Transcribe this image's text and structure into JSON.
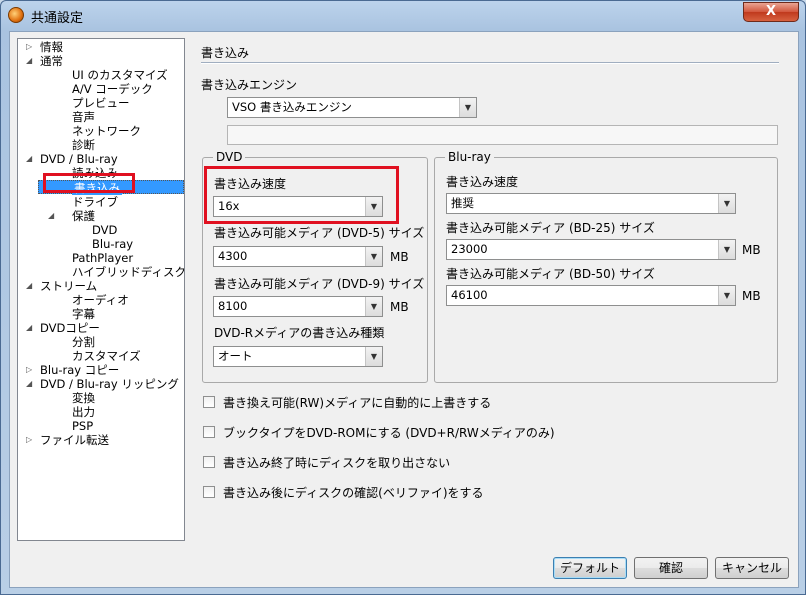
{
  "window": {
    "title": "共通設定",
    "close_label": "X"
  },
  "tree": [
    {
      "label": "情報",
      "indent": 0,
      "expander": "closed"
    },
    {
      "label": "通常",
      "indent": 0,
      "expander": "open"
    },
    {
      "label": "UI のカスタマイズ",
      "indent": 1,
      "expander": ""
    },
    {
      "label": "A/V コーデック",
      "indent": 1,
      "expander": ""
    },
    {
      "label": "プレビュー",
      "indent": 1,
      "expander": ""
    },
    {
      "label": "音声",
      "indent": 1,
      "expander": ""
    },
    {
      "label": "ネットワーク",
      "indent": 1,
      "expander": ""
    },
    {
      "label": "診断",
      "indent": 1,
      "expander": ""
    },
    {
      "label": "DVD / Blu-ray",
      "indent": 0,
      "expander": "open"
    },
    {
      "label": "読み込み",
      "indent": 1,
      "expander": ""
    },
    {
      "label": "書き込み",
      "indent": 1,
      "expander": "",
      "selected": true
    },
    {
      "label": "ドライブ",
      "indent": 1,
      "expander": ""
    },
    {
      "label": "保護",
      "indent": 1,
      "expander": "open"
    },
    {
      "label": "DVD",
      "indent": 2,
      "expander": ""
    },
    {
      "label": "Blu-ray",
      "indent": 2,
      "expander": ""
    },
    {
      "label": "PathPlayer",
      "indent": 1,
      "expander": ""
    },
    {
      "label": "ハイブリッドディスク",
      "indent": 1,
      "expander": ""
    },
    {
      "label": "ストリーム",
      "indent": 0,
      "expander": "open"
    },
    {
      "label": "オーディオ",
      "indent": 1,
      "expander": ""
    },
    {
      "label": "字幕",
      "indent": 1,
      "expander": ""
    },
    {
      "label": "DVDコピー",
      "indent": 0,
      "expander": "open"
    },
    {
      "label": "分割",
      "indent": 1,
      "expander": ""
    },
    {
      "label": "カスタマイズ",
      "indent": 1,
      "expander": ""
    },
    {
      "label": "Blu-ray コピー",
      "indent": 0,
      "expander": "closed"
    },
    {
      "label": "DVD / Blu-ray リッピング",
      "indent": 0,
      "expander": "open"
    },
    {
      "label": "変換",
      "indent": 1,
      "expander": ""
    },
    {
      "label": "出力",
      "indent": 1,
      "expander": ""
    },
    {
      "label": "PSP",
      "indent": 1,
      "expander": ""
    },
    {
      "label": "ファイル転送",
      "indent": 0,
      "expander": "closed"
    }
  ],
  "panel": {
    "title": "書き込み",
    "engine_label": "書き込みエンジン",
    "engine_value": "VSO 書き込みエンジン",
    "dvd": {
      "group_title": "DVD",
      "speed_label": "書き込み速度",
      "speed_value": "16x",
      "dvd5_label": "書き込み可能メディア (DVD-5) サイズ",
      "dvd5_value": "4300",
      "dvd9_label": "書き込み可能メディア (DVD-9) サイズ",
      "dvd9_value": "8100",
      "dvdr_label": "DVD-Rメディアの書き込み種類",
      "dvdr_value": "オート",
      "unit": "MB"
    },
    "bluray": {
      "group_title": "Blu-ray",
      "speed_label": "書き込み速度",
      "speed_value": "推奨",
      "bd25_label": "書き込み可能メディア (BD-25) サイズ",
      "bd25_value": "23000",
      "bd50_label": "書き込み可能メディア (BD-50) サイズ",
      "bd50_value": "46100",
      "unit": "MB"
    },
    "options": [
      "書き換え可能(RW)メディアに自動的に上書きする",
      "ブックタイプをDVD-ROMにする (DVD+R/RWメディアのみ)",
      "書き込み終了時にディスクを取り出さない",
      "書き込み後にディスクの確認(ベリファイ)をする"
    ]
  },
  "buttons": {
    "default": "デフォルト",
    "ok": "確認",
    "cancel": "キャンセル"
  },
  "icons": {
    "expand_open": "◢",
    "expand_closed": "▷",
    "dropdown": "▼"
  },
  "colors": {
    "highlight": "#e01020",
    "selection": "#3399ff"
  }
}
